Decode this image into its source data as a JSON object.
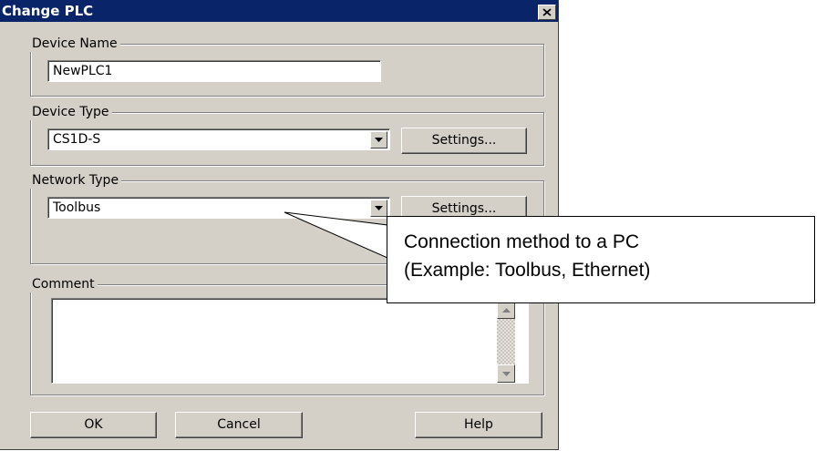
{
  "dialog": {
    "title": "Change PLC",
    "close_icon": "close-icon"
  },
  "device_name": {
    "legend": "Device Name",
    "value": "NewPLC1"
  },
  "device_type": {
    "legend": "Device Type",
    "value": "CS1D-S",
    "settings_label": "Settings..."
  },
  "network_type": {
    "legend": "Network Type",
    "value": "Toolbus",
    "settings_label": "Settings..."
  },
  "comment": {
    "legend": "Comment",
    "value": ""
  },
  "buttons": {
    "ok": "OK",
    "cancel": "Cancel",
    "help": "Help"
  },
  "callout": {
    "line1": "Connection method to a PC",
    "line2": "(Example: Toolbus, Ethernet)"
  }
}
